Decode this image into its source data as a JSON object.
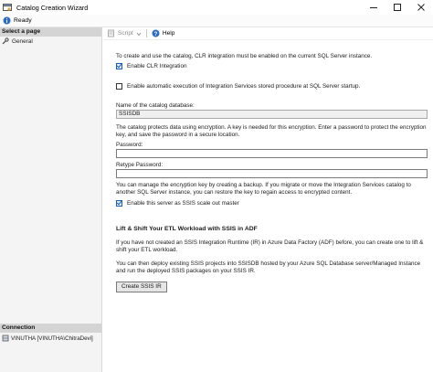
{
  "window": {
    "title": "Catalog Creation Wizard",
    "icon": "wizard-icon",
    "controls": [
      "minimize-icon",
      "maximize-icon",
      "close-icon"
    ]
  },
  "status": {
    "text": "Ready",
    "icon": "info-icon"
  },
  "sidebar": {
    "select_page_header": "Select a page",
    "pages": [
      {
        "label": "General",
        "icon": "wrench-icon"
      }
    ],
    "connection_header": "Connection",
    "connection": "VINUTHA [VINUTHA\\ChitraDevi]"
  },
  "toolbar": {
    "script_label": "Script",
    "help_label": "Help"
  },
  "general": {
    "clr_note": "To create and use the catalog, CLR integration must be enabled on the current SQL Server instance.",
    "enable_clr_label": "Enable CLR Integration",
    "enable_clr_checked": true,
    "auto_exec_label": "Enable automatic execution of Integration Services stored procedure at SQL Server startup.",
    "auto_exec_checked": false,
    "catalog_name_label": "Name of the catalog database:",
    "catalog_name_value": "SSISDB",
    "encryption_note": "The catalog protects data using encryption. A key is needed for this encryption. Enter a password to protect the encryption key, and save the password in a secure location.",
    "password_label": "Password:",
    "password_value": "",
    "retype_label": "Retype Password:",
    "retype_value": "",
    "backup_note": "You can manage the encryption key by creating a backup. If you migrate or move the Integration Services catalog to another SQL Server instance, you can restore the key to regain access to encrypted content.",
    "scale_out_label": "Enable this server as SSIS scale out master",
    "scale_out_checked": true,
    "adf_heading": "Lift & Shift Your ETL Workload with SSIS in ADF",
    "adf_para1": "If you have not created an SSIS Integration Runtime (IR) in Azure Data Factory (ADF) before, you can create one to lift & shift your ETL workload.",
    "adf_para2": "You can then deploy existing SSIS projects into SSISDB hosted by your Azure SQL Database server/Managed Instance and run the deployed SSIS packages on your SSIS IR.",
    "create_ir_label": "Create SSIS IR"
  }
}
